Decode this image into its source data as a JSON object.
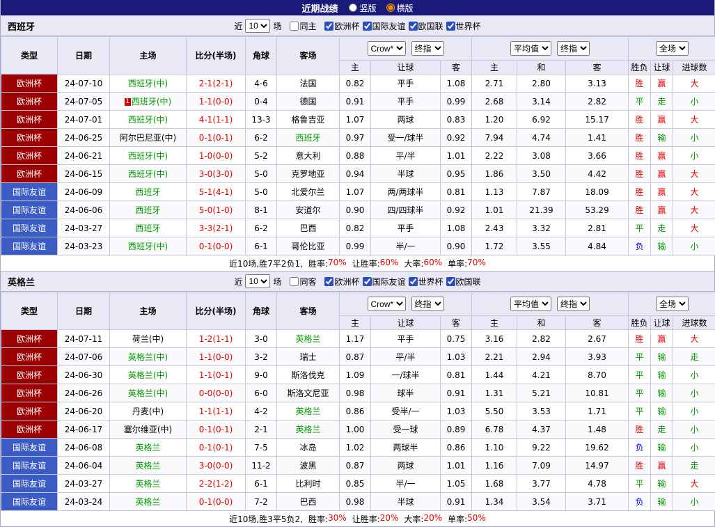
{
  "topbar": {
    "title": "近期战绩",
    "options": [
      {
        "label": "竖版",
        "selected": false
      },
      {
        "label": "横版",
        "selected": true
      }
    ]
  },
  "table_header": {
    "static_cols": [
      "类型",
      "日期",
      "主场",
      "比分(半场)",
      "角球",
      "客场"
    ],
    "group1": {
      "select_a": "Crow*",
      "select_b": "终指",
      "sub_cols": [
        "主",
        "让球",
        "客"
      ]
    },
    "group2": {
      "select_a": "平均值",
      "select_b": "终指",
      "sub_cols": [
        "主",
        "和",
        "客"
      ]
    },
    "group3": {
      "select_a": "全场",
      "sub_cols": [
        "胜负",
        "让球",
        "进球数"
      ]
    }
  },
  "colors": {
    "league": {
      "欧洲杯": "#9c0000",
      "国际友谊": "#3c5cc5"
    },
    "result": {
      "red": "#e60000",
      "green": "#009900",
      "blue": "#0000ee"
    },
    "score": "#e60000",
    "team_green": "#009900",
    "accent": "#1a1a78"
  },
  "filter_common": {
    "prefix": "近",
    "count": "10",
    "suffix": "场"
  },
  "sections": [
    {
      "team": "西班牙",
      "filter": {
        "same_label": "同主",
        "same_checked": false,
        "leagues": [
          {
            "label": "欧洲杯",
            "checked": true
          },
          {
            "label": "国际友谊",
            "checked": true
          },
          {
            "label": "欧国联",
            "checked": true
          },
          {
            "label": "世界杯",
            "checked": true
          }
        ]
      },
      "rows": [
        {
          "league": "欧洲杯",
          "date": "24-07-10",
          "home": "西班牙(中)",
          "home_green": true,
          "badge": "",
          "score": "2-1(2-1)",
          "corner": "4-6",
          "away": "法国",
          "away_green": false,
          "odds": [
            "0.82",
            "平手",
            "1.08"
          ],
          "avg": [
            "2.71",
            "2.80",
            "3.13"
          ],
          "res": [
            [
              "胜",
              "red"
            ],
            [
              "赢",
              "red"
            ],
            [
              "大",
              "red"
            ]
          ]
        },
        {
          "league": "欧洲杯",
          "date": "24-07-05",
          "home": "西班牙(中)",
          "home_green": true,
          "badge": "1",
          "score": "1-1(0-0)",
          "corner": "0-4",
          "away": "德国",
          "away_green": false,
          "odds": [
            "0.91",
            "平手",
            "0.99"
          ],
          "avg": [
            "2.68",
            "3.14",
            "2.82"
          ],
          "res": [
            [
              "平",
              "green"
            ],
            [
              "走",
              "green"
            ],
            [
              "小",
              "green"
            ]
          ]
        },
        {
          "league": "欧洲杯",
          "date": "24-07-01",
          "home": "西班牙(中)",
          "home_green": true,
          "badge": "",
          "score": "4-1(1-1)",
          "corner": "13-3",
          "away": "格鲁吉亚",
          "away_green": false,
          "odds": [
            "1.07",
            "两球",
            "0.83"
          ],
          "avg": [
            "1.20",
            "6.92",
            "15.17"
          ],
          "res": [
            [
              "胜",
              "red"
            ],
            [
              "赢",
              "red"
            ],
            [
              "大",
              "red"
            ]
          ]
        },
        {
          "league": "欧洲杯",
          "date": "24-06-25",
          "home": "阿尔巴尼亚(中)",
          "home_green": false,
          "badge": "",
          "score": "0-1(0-1)",
          "corner": "6-2",
          "away": "西班牙",
          "away_green": true,
          "odds": [
            "0.97",
            "受一/球半",
            "0.92"
          ],
          "avg": [
            "7.94",
            "4.74",
            "1.41"
          ],
          "res": [
            [
              "胜",
              "red"
            ],
            [
              "输",
              "green"
            ],
            [
              "小",
              "green"
            ]
          ]
        },
        {
          "league": "欧洲杯",
          "date": "24-06-21",
          "home": "西班牙(中)",
          "home_green": true,
          "badge": "",
          "score": "1-0(0-0)",
          "corner": "5-2",
          "away": "意大利",
          "away_green": false,
          "odds": [
            "0.88",
            "平/半",
            "1.01"
          ],
          "avg": [
            "2.22",
            "3.08",
            "3.66"
          ],
          "res": [
            [
              "胜",
              "red"
            ],
            [
              "赢",
              "red"
            ],
            [
              "小",
              "green"
            ]
          ]
        },
        {
          "league": "欧洲杯",
          "date": "24-06-15",
          "home": "西班牙(中)",
          "home_green": true,
          "badge": "",
          "score": "3-0(3-0)",
          "corner": "5-0",
          "away": "克罗地亚",
          "away_green": false,
          "odds": [
            "0.94",
            "半球",
            "0.95"
          ],
          "avg": [
            "1.86",
            "3.50",
            "4.42"
          ],
          "res": [
            [
              "胜",
              "red"
            ],
            [
              "赢",
              "red"
            ],
            [
              "大",
              "red"
            ]
          ]
        },
        {
          "league": "国际友谊",
          "date": "24-06-09",
          "home": "西班牙",
          "home_green": true,
          "badge": "",
          "score": "5-1(4-1)",
          "corner": "5-0",
          "away": "北爱尔兰",
          "away_green": false,
          "odds": [
            "1.07",
            "两/两球半",
            "0.81"
          ],
          "avg": [
            "1.13",
            "7.87",
            "18.09"
          ],
          "res": [
            [
              "胜",
              "red"
            ],
            [
              "赢",
              "red"
            ],
            [
              "大",
              "red"
            ]
          ]
        },
        {
          "league": "国际友谊",
          "date": "24-06-06",
          "home": "西班牙",
          "home_green": true,
          "badge": "",
          "score": "5-0(1-0)",
          "corner": "8-1",
          "away": "安道尔",
          "away_green": false,
          "odds": [
            "0.90",
            "四/四球半",
            "0.92"
          ],
          "avg": [
            "1.01",
            "21.39",
            "53.29"
          ],
          "res": [
            [
              "胜",
              "red"
            ],
            [
              "赢",
              "red"
            ],
            [
              "大",
              "red"
            ]
          ]
        },
        {
          "league": "国际友谊",
          "date": "24-03-27",
          "home": "西班牙",
          "home_green": true,
          "badge": "",
          "score": "3-3(2-1)",
          "corner": "6-2",
          "away": "巴西",
          "away_green": false,
          "odds": [
            "0.82",
            "平手",
            "1.08"
          ],
          "avg": [
            "2.43",
            "3.32",
            "2.81"
          ],
          "res": [
            [
              "平",
              "green"
            ],
            [
              "走",
              "green"
            ],
            [
              "大",
              "red"
            ]
          ]
        },
        {
          "league": "国际友谊",
          "date": "24-03-23",
          "home": "西班牙(中)",
          "home_green": true,
          "badge": "",
          "score": "0-1(0-0)",
          "corner": "6-1",
          "away": "哥伦比亚",
          "away_green": false,
          "odds": [
            "0.99",
            "半/一",
            "0.90"
          ],
          "avg": [
            "1.72",
            "3.55",
            "4.84"
          ],
          "res": [
            [
              "负",
              "blue"
            ],
            [
              "输",
              "green"
            ],
            [
              "小",
              "green"
            ]
          ]
        }
      ],
      "summary": {
        "prefix": "近10场,胜7平2负1,",
        "stats": [
          {
            "label": "胜率:",
            "value": "70%"
          },
          {
            "label": "让胜率:",
            "value": "60%"
          },
          {
            "label": "大率:",
            "value": "60%"
          },
          {
            "label": "单率:",
            "value": "70%"
          }
        ]
      }
    },
    {
      "team": "英格兰",
      "filter": {
        "same_label": "同客",
        "same_checked": false,
        "leagues": [
          {
            "label": "欧洲杯",
            "checked": true
          },
          {
            "label": "国际友谊",
            "checked": true
          },
          {
            "label": "世界杯",
            "checked": true
          },
          {
            "label": "欧国联",
            "checked": true
          }
        ]
      },
      "rows": [
        {
          "league": "欧洲杯",
          "date": "24-07-11",
          "home": "荷兰(中)",
          "home_green": false,
          "badge": "",
          "score": "1-2(1-1)",
          "corner": "3-0",
          "away": "英格兰",
          "away_green": true,
          "odds": [
            "1.17",
            "平手",
            "0.75"
          ],
          "avg": [
            "3.16",
            "2.82",
            "2.67"
          ],
          "res": [
            [
              "胜",
              "red"
            ],
            [
              "赢",
              "red"
            ],
            [
              "大",
              "red"
            ]
          ]
        },
        {
          "league": "欧洲杯",
          "date": "24-07-06",
          "home": "英格兰(中)",
          "home_green": true,
          "badge": "",
          "score": "1-1(0-0)",
          "corner": "3-2",
          "away": "瑞士",
          "away_green": false,
          "odds": [
            "0.87",
            "平/半",
            "1.03"
          ],
          "avg": [
            "2.21",
            "2.94",
            "3.93"
          ],
          "res": [
            [
              "平",
              "green"
            ],
            [
              "输",
              "green"
            ],
            [
              "走",
              "green"
            ]
          ]
        },
        {
          "league": "欧洲杯",
          "date": "24-06-30",
          "home": "英格兰(中)",
          "home_green": true,
          "badge": "",
          "score": "1-1(0-1)",
          "corner": "9-0",
          "away": "斯洛伐克",
          "away_green": false,
          "odds": [
            "1.09",
            "一/球半",
            "0.81"
          ],
          "avg": [
            "1.44",
            "4.21",
            "8.70"
          ],
          "res": [
            [
              "平",
              "green"
            ],
            [
              "输",
              "green"
            ],
            [
              "小",
              "green"
            ]
          ]
        },
        {
          "league": "欧洲杯",
          "date": "24-06-26",
          "home": "英格兰(中)",
          "home_green": true,
          "badge": "",
          "score": "0-0(0-0)",
          "corner": "6-0",
          "away": "斯洛文尼亚",
          "away_green": false,
          "odds": [
            "0.98",
            "球半",
            "0.91"
          ],
          "avg": [
            "1.31",
            "5.21",
            "10.81"
          ],
          "res": [
            [
              "平",
              "green"
            ],
            [
              "输",
              "green"
            ],
            [
              "小",
              "green"
            ]
          ]
        },
        {
          "league": "欧洲杯",
          "date": "24-06-20",
          "home": "丹麦(中)",
          "home_green": false,
          "badge": "",
          "score": "1-1(1-1)",
          "corner": "4-2",
          "away": "英格兰",
          "away_green": true,
          "odds": [
            "0.86",
            "受半/一",
            "1.03"
          ],
          "avg": [
            "5.50",
            "3.53",
            "1.71"
          ],
          "res": [
            [
              "平",
              "green"
            ],
            [
              "输",
              "green"
            ],
            [
              "小",
              "green"
            ]
          ]
        },
        {
          "league": "欧洲杯",
          "date": "24-06-17",
          "home": "塞尔维亚(中)",
          "home_green": false,
          "badge": "",
          "score": "0-1(0-1)",
          "corner": "2-1",
          "away": "英格兰",
          "away_green": true,
          "odds": [
            "1.00",
            "受一球",
            "0.89"
          ],
          "avg": [
            "6.78",
            "4.37",
            "1.48"
          ],
          "res": [
            [
              "胜",
              "red"
            ],
            [
              "走",
              "green"
            ],
            [
              "小",
              "green"
            ]
          ]
        },
        {
          "league": "国际友谊",
          "date": "24-06-08",
          "home": "英格兰",
          "home_green": true,
          "badge": "",
          "score": "0-1(0-1)",
          "corner": "7-5",
          "away": "冰岛",
          "away_green": false,
          "odds": [
            "1.02",
            "两球半",
            "0.86"
          ],
          "avg": [
            "1.10",
            "9.22",
            "19.62"
          ],
          "res": [
            [
              "负",
              "blue"
            ],
            [
              "输",
              "green"
            ],
            [
              "小",
              "green"
            ]
          ]
        },
        {
          "league": "国际友谊",
          "date": "24-06-04",
          "home": "英格兰",
          "home_green": true,
          "badge": "",
          "score": "3-0(0-0)",
          "corner": "11-2",
          "away": "波黑",
          "away_green": false,
          "odds": [
            "0.87",
            "两球",
            "1.01"
          ],
          "avg": [
            "1.16",
            "7.09",
            "14.97"
          ],
          "res": [
            [
              "胜",
              "red"
            ],
            [
              "赢",
              "red"
            ],
            [
              "走",
              "green"
            ]
          ]
        },
        {
          "league": "国际友谊",
          "date": "24-03-27",
          "home": "英格兰",
          "home_green": true,
          "badge": "",
          "score": "2-2(1-2)",
          "corner": "6-1",
          "away": "比利时",
          "away_green": false,
          "odds": [
            "0.85",
            "半/一",
            "1.05"
          ],
          "avg": [
            "1.68",
            "3.77",
            "4.78"
          ],
          "res": [
            [
              "平",
              "green"
            ],
            [
              "输",
              "green"
            ],
            [
              "大",
              "red"
            ]
          ]
        },
        {
          "league": "国际友谊",
          "date": "24-03-24",
          "home": "英格兰",
          "home_green": true,
          "badge": "",
          "score": "0-1(0-0)",
          "corner": "7-2",
          "away": "巴西",
          "away_green": false,
          "odds": [
            "0.98",
            "半球",
            "0.91"
          ],
          "avg": [
            "1.34",
            "3.54",
            "3.71"
          ],
          "res": [
            [
              "负",
              "blue"
            ],
            [
              "输",
              "green"
            ],
            [
              "小",
              "green"
            ]
          ]
        }
      ],
      "summary": {
        "prefix": "近10场,胜3平5负2,",
        "stats": [
          {
            "label": "胜率:",
            "value": "30%"
          },
          {
            "label": "让胜率:",
            "value": "20%"
          },
          {
            "label": "大率:",
            "value": "20%"
          },
          {
            "label": "单率:",
            "value": "50%"
          }
        ]
      }
    }
  ]
}
